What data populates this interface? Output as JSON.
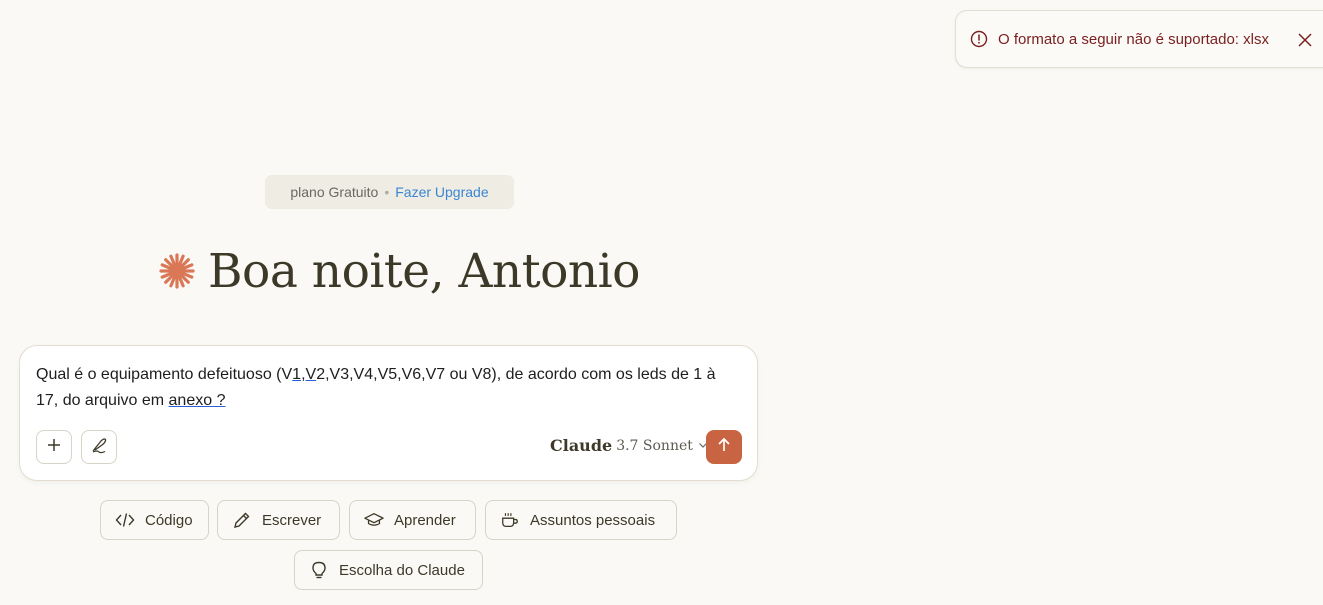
{
  "toast": {
    "message": "O formato a seguir não é suportado: xlsx"
  },
  "plan": {
    "label": "plano Gratuito",
    "separator": "•",
    "upgrade": "Fazer Upgrade"
  },
  "greeting": {
    "text": "Boa noite, Antonio"
  },
  "composer": {
    "prompt_part1": "Qual é o equipamento defeituoso (V",
    "prompt_u1": "1,V",
    "prompt_part2": "2,V3,V4,V5,V6,V7 ou V8), de acordo com os leds de 1 à 17, do arquivo em ",
    "prompt_u2": "anexo ?",
    "model_name": "Claude",
    "model_version": "3.7 Sonnet"
  },
  "chips": [
    {
      "label": "Código",
      "icon": "code-icon"
    },
    {
      "label": "Escrever",
      "icon": "pencil-icon"
    },
    {
      "label": "Aprender",
      "icon": "graduation-cap-icon"
    },
    {
      "label": "Assuntos pessoais",
      "icon": "coffee-icon"
    },
    {
      "label": "Escolha do Claude",
      "icon": "lightbulb-icon"
    }
  ],
  "colors": {
    "accent": "#c96442",
    "background": "#faf9f5",
    "link": "#3a86d4",
    "error": "#7a1f1f"
  }
}
